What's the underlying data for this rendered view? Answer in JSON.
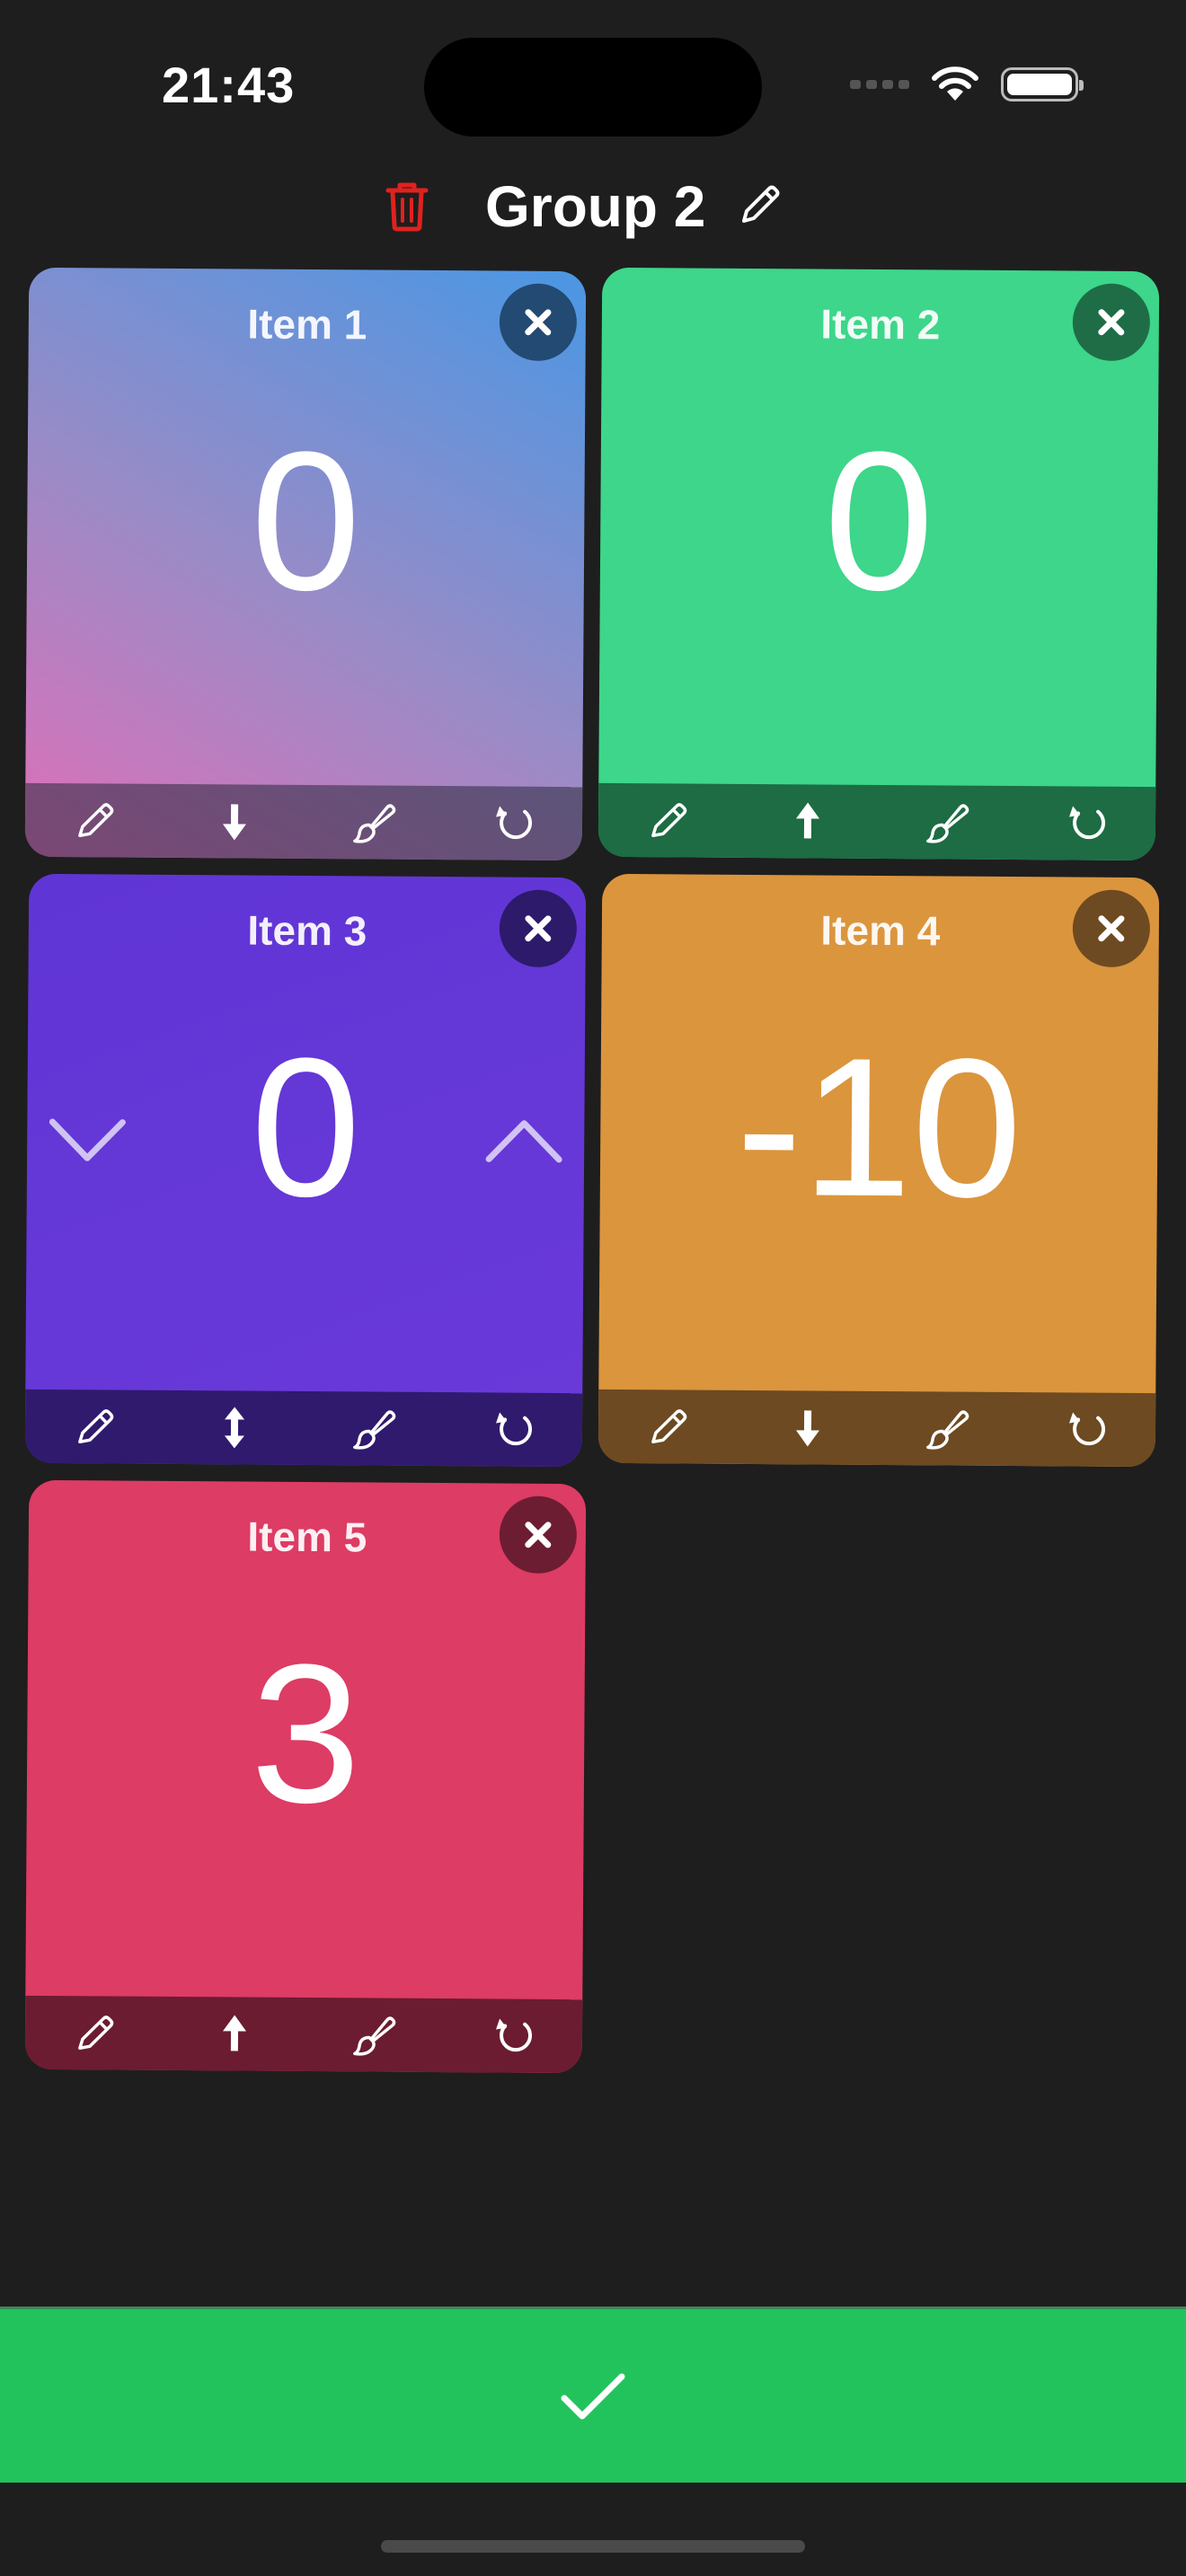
{
  "status_bar": {
    "time": "21:43"
  },
  "header": {
    "title": "Group 2"
  },
  "items": [
    {
      "name": "Item 1",
      "value": "0"
    },
    {
      "name": "Item 2",
      "value": "0"
    },
    {
      "name": "Item 3",
      "value": "0"
    },
    {
      "name": "Item 4",
      "value": "-10"
    },
    {
      "name": "Item 5",
      "value": "3"
    }
  ],
  "colors": {
    "background": "#1e1e1e",
    "trash": "#e0221f",
    "confirm": "#22c35c",
    "item_2": "#3dd68a",
    "item_3": "#6035d6",
    "item_4": "#db953d",
    "item_5": "#dd3c64"
  },
  "icons": {
    "card_toolbar": [
      "pencil-icon",
      "sort-direction-icon",
      "brush-icon",
      "reset-icon"
    ],
    "header": [
      "trash-icon",
      "pencil-icon"
    ],
    "confirm": "checkmark-icon"
  }
}
